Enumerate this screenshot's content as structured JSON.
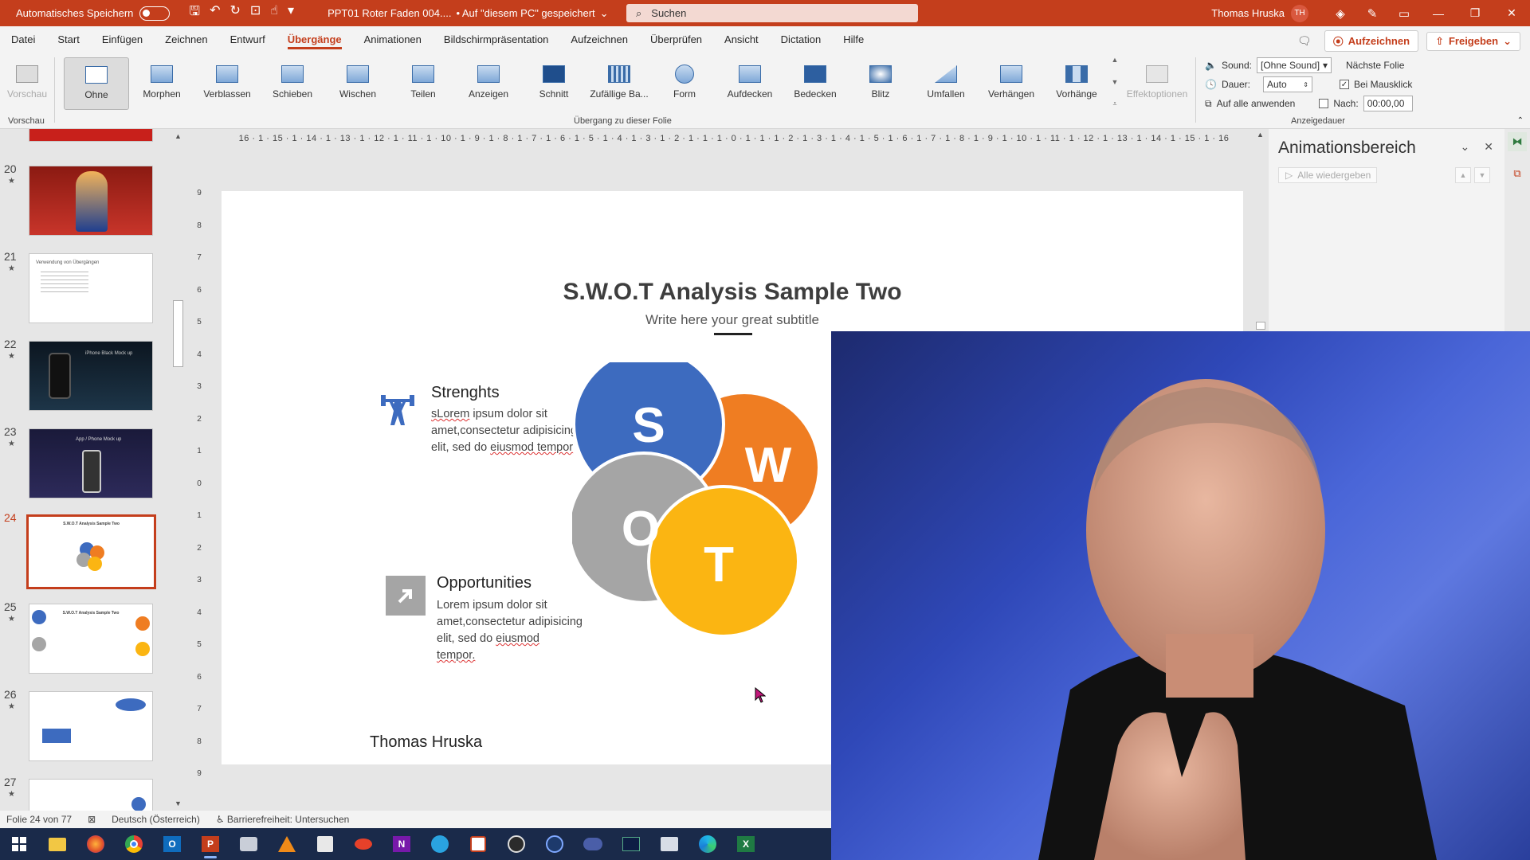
{
  "titlebar": {
    "autosave_label": "Automatisches Speichern",
    "doc_name": "PPT01 Roter Faden 004....",
    "save_state": "• Auf \"diesem PC\" gespeichert",
    "search_placeholder": "Suchen",
    "user_name": "Thomas Hruska",
    "user_initials": "TH"
  },
  "menu": {
    "items": [
      "Datei",
      "Start",
      "Einfügen",
      "Zeichnen",
      "Entwurf",
      "Übergänge",
      "Animationen",
      "Bildschirmpräsentation",
      "Aufzeichnen",
      "Überprüfen",
      "Ansicht",
      "Dictation",
      "Hilfe"
    ],
    "active": "Übergänge",
    "record_label": "Aufzeichnen",
    "share_label": "Freigeben"
  },
  "ribbon": {
    "preview_label": "Vorschau",
    "preview_group": "Vorschau",
    "transitions_group": "Übergang zu dieser Folie",
    "transitions": [
      "Ohne",
      "Morphen",
      "Verblassen",
      "Schieben",
      "Wischen",
      "Teilen",
      "Anzeigen",
      "Schnitt",
      "Zufällige Ba...",
      "Form",
      "Aufdecken",
      "Bedecken",
      "Blitz",
      "Umfallen",
      "Verhängen",
      "Vorhänge"
    ],
    "selected_transition": "Ohne",
    "effect_options_label": "Effektoptionen",
    "sound_label": "Sound:",
    "sound_value": "[Ohne Sound]",
    "duration_label": "Dauer:",
    "duration_value": "Auto",
    "apply_all_label": "Auf alle anwenden",
    "next_slide_label": "Nächste Folie",
    "on_click_label": "Bei Mausklick",
    "on_click_checked": true,
    "after_label": "Nach:",
    "after_value": "00:00,00",
    "after_checked": false,
    "timing_group": "Anzeigedauer"
  },
  "thumbnails": {
    "slides": [
      {
        "num": "20",
        "star": "★"
      },
      {
        "num": "21",
        "star": "★",
        "title": "Verwendung von Übergängen"
      },
      {
        "num": "22",
        "star": "★",
        "title": "iPhone Black Mock up"
      },
      {
        "num": "23",
        "star": "★",
        "title": "App / Phone Mock up"
      },
      {
        "num": "24",
        "star": "★",
        "title": "S.W.O.T Analysis Sample Two"
      },
      {
        "num": "25",
        "star": "★",
        "title": "S.W.O.T Analysis Sample Two"
      },
      {
        "num": "26",
        "star": "★"
      },
      {
        "num": "27",
        "star": "★"
      }
    ],
    "current": "24"
  },
  "ruler": {
    "horizontal": "16 · 1 · 15 · 1 · 14 · 1 · 13 · 1 · 12 · 1 · 11 · 1 · 10 · 1 · 9 · 1 · 8 · 1 · 7 · 1 · 6 · 1 · 5 · 1 · 4 · 1 · 3 · 1 · 2 · 1 · 1 · 1 · 0 · 1 · 1 · 1 · 2 · 1 · 3 · 1 · 4 · 1 · 5 · 1 · 6 · 1 · 7 · 1 · 8 · 1 · 9 · 1 · 10 · 1 · 11 · 1 · 12 · 1 · 13 · 1 · 14 · 1 · 15 · 1 · 16",
    "vertical": [
      "9",
      "8",
      "7",
      "6",
      "5",
      "4",
      "3",
      "2",
      "1",
      "0",
      "1",
      "2",
      "3",
      "4",
      "5",
      "6",
      "7",
      "8",
      "9"
    ]
  },
  "slide": {
    "title": "S.W.O.T Analysis Sample Two",
    "subtitle": "Write here your great subtitle",
    "strengths_title": "Strenghts",
    "strengths_text_1": "sLorem",
    "strengths_text_2": " ipsum dolor sit",
    "strengths_text_3": "amet,consectetur adipisicing",
    "strengths_text_4": "elit, sed do ",
    "strengths_text_5": "eiusmod tempor",
    "opportunities_title": "Opportunities",
    "opp_text_1": "Lorem ipsum dolor sit",
    "opp_text_2": "amet,consectetur adipisicing",
    "opp_text_3": "elit, sed do ",
    "opp_text_4": "eiusmod",
    "opp_text_5": "tempor.",
    "letters": {
      "s": "S",
      "w": "W",
      "o": "O",
      "t": "T"
    },
    "presenter": "Thomas Hruska",
    "colors": {
      "s": "#3d6bbf",
      "w": "#ef7d22",
      "o": "#a5a5a5",
      "t": "#fbb512"
    }
  },
  "anim_panel": {
    "title": "Animationsbereich",
    "play_all": "Alle wiedergeben"
  },
  "statusbar": {
    "slide_info": "Folie 24 von 77",
    "language": "Deutsch (Österreich)",
    "accessibility": "Barrierefreiheit: Untersuchen"
  },
  "taskbar": {
    "icons": [
      "windows-start-icon",
      "file-explorer-icon",
      "firefox-icon",
      "chrome-icon",
      "outlook-icon",
      "powerpoint-icon",
      "app-icon",
      "vlc-icon",
      "app-icon-2",
      "app-icon-3",
      "onenote-icon",
      "telegram-icon",
      "app-icon-4",
      "obs-icon",
      "app-icon-5",
      "app-icon-6",
      "app-icon-7",
      "app-icon-8",
      "edge-icon",
      "excel-icon"
    ]
  }
}
